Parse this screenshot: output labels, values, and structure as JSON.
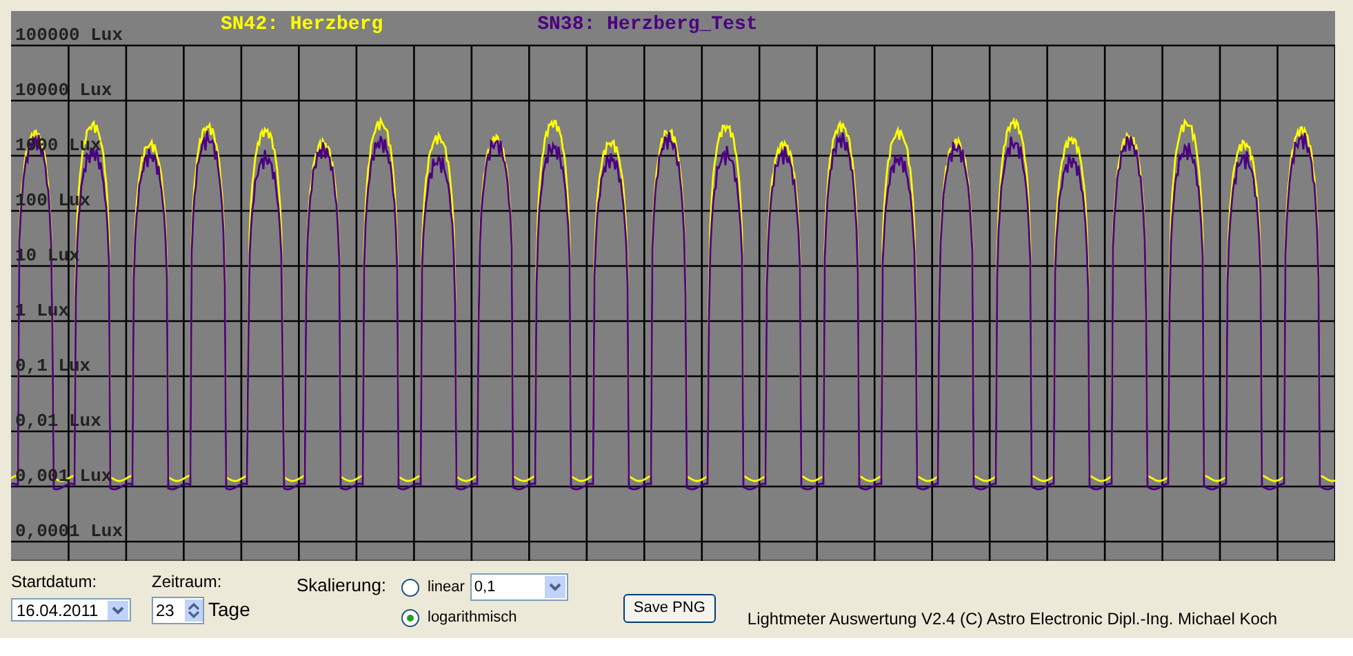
{
  "chart": {
    "legend": [
      {
        "label": "SN42: Herzberg",
        "color": "#ffff00"
      },
      {
        "label": "SN38: Herzberg_Test",
        "color": "#4b0082"
      }
    ],
    "y_labels": [
      "100000 Lux",
      "10000 Lux",
      "1000 Lux",
      "100 Lux",
      "10 Lux",
      "1 Lux",
      "0,1 Lux",
      "0,01 Lux",
      "0,001 Lux",
      "0,0001 Lux"
    ]
  },
  "start_date": {
    "label": "Startdatum:",
    "value": "16.04.2011"
  },
  "period": {
    "label": "Zeitraum:",
    "value": "23",
    "unit": "Tage"
  },
  "scaling": {
    "label": "Skalierung:",
    "options": [
      {
        "label": "linear",
        "selected": false
      },
      {
        "label": "logarithmisch",
        "selected": true
      }
    ],
    "linear_value": "0,1"
  },
  "save_button": "Save PNG",
  "footer": "Lightmeter Auswertung V2.4  (C) Astro Electronic Dipl.-Ing. Michael Koch"
}
